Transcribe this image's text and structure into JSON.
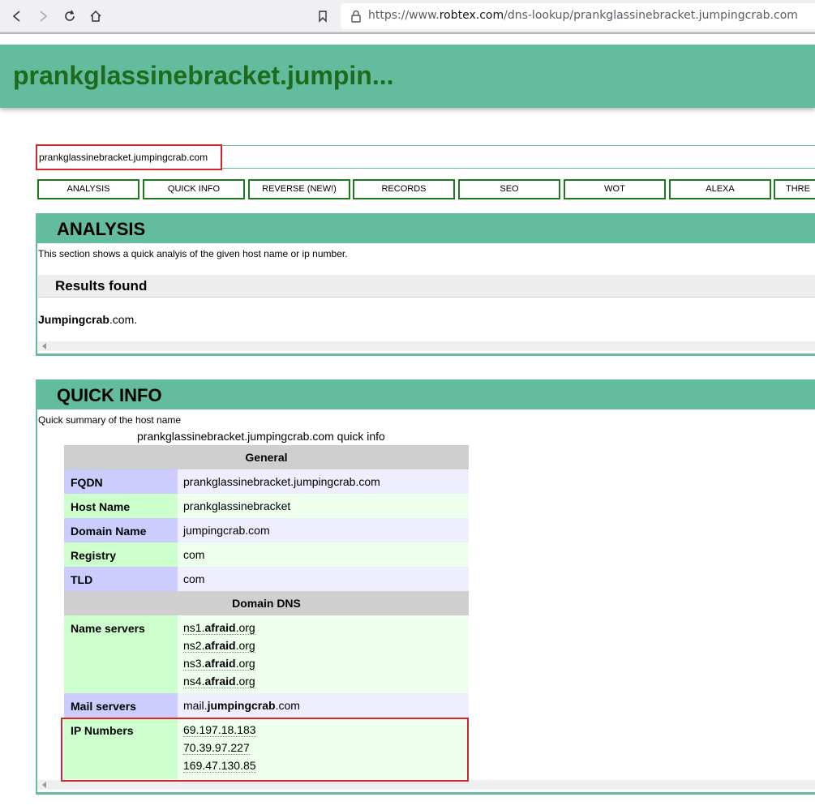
{
  "browser": {
    "url_prefix": "https://www.",
    "url_domain": "robtex.com",
    "url_path": "/dns-lookup/prankglassinebracket.jumpingcrab.com"
  },
  "header": {
    "title": "prankglassinebracket.jumpin..."
  },
  "search": {
    "value": "prankglassinebracket.jumpingcrab.com"
  },
  "tabs": [
    "ANALYSIS",
    "QUICK INFO",
    "REVERSE (NEW!)",
    "RECORDS",
    "SEO",
    "WOT",
    "ALEXA",
    "THRE"
  ],
  "analysis": {
    "title": "ANALYSIS",
    "description": "This section shows a quick analyis of the given host name or ip number.",
    "results_title": "Results found",
    "result_bold": "Jumpingcrab",
    "result_rest": ".com."
  },
  "quick_info": {
    "title": "QUICK INFO",
    "description": "Quick summary of the host name",
    "caption": "prankglassinebracket.jumpingcrab.com quick info",
    "general_header": "General",
    "dns_header": "Domain DNS",
    "fqdn_label": "FQDN",
    "fqdn_value": "prankglassinebracket.jumpingcrab.com",
    "hostname_label": "Host Name",
    "hostname_value": "prankglassinebracket",
    "domain_label": "Domain Name",
    "domain_value": "jumpingcrab.com",
    "registry_label": "Registry",
    "registry_value": "com",
    "tld_label": "TLD",
    "tld_value": "com",
    "ns_label": "Name servers",
    "name_servers": [
      {
        "pre": "ns1.",
        "bold": "afraid",
        "post": ".org"
      },
      {
        "pre": "ns2.",
        "bold": "afraid",
        "post": ".org"
      },
      {
        "pre": "ns3.",
        "bold": "afraid",
        "post": ".org"
      },
      {
        "pre": "ns4.",
        "bold": "afraid",
        "post": ".org"
      }
    ],
    "mail_label": "Mail servers",
    "mail": {
      "pre": "mail.",
      "bold": "jumpingcrab",
      "post": ".com"
    },
    "ip_label": "IP Numbers",
    "ip_numbers": [
      "69.197.18.183",
      "70.39.97.227",
      "169.47.130.85"
    ]
  },
  "colors": {
    "header_green": "#62bc9d",
    "title_green": "#1e6b1e",
    "highlight_red": "#d0282c"
  }
}
